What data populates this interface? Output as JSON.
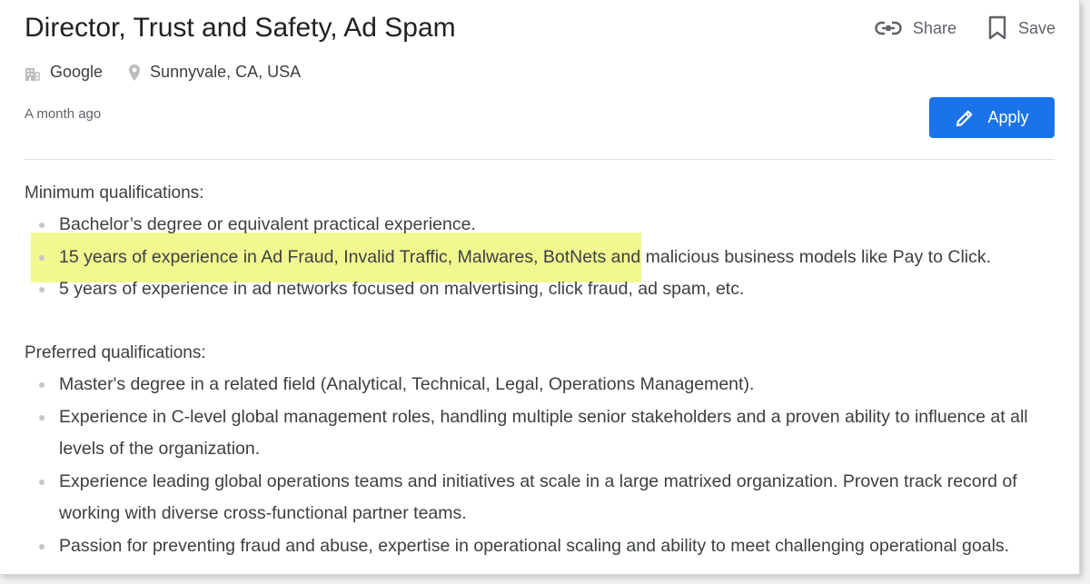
{
  "job": {
    "title": "Director, Trust and Safety, Ad Spam",
    "company": "Google",
    "location": "Sunnyvale, CA, USA",
    "posted": "A month ago"
  },
  "actions": {
    "share_label": "Share",
    "save_label": "Save",
    "apply_label": "Apply"
  },
  "icons": {
    "company": "building-icon",
    "location": "location-pin-icon",
    "share": "link-icon",
    "save": "bookmark-icon",
    "apply": "pencil-icon"
  },
  "colors": {
    "accent": "#1a73e8",
    "highlight": "#eef77b"
  },
  "minimum": {
    "title": "Minimum qualifications:",
    "items": [
      "Bachelor’s degree or equivalent practical experience.",
      "15 years of experience in Ad Fraud, Invalid Traffic, Malwares, BotNets and malicious business models like Pay to Click.",
      "5 years of experience in ad networks focused on malvertising, click fraud, ad spam, etc."
    ]
  },
  "preferred": {
    "title": "Preferred qualifications:",
    "items": [
      "Master's degree in a related field (Analytical, Technical, Legal, Operations Management).",
      "Experience in C-level global management roles, handling multiple senior stakeholders and a proven ability to influence at all levels of the organization.",
      "Experience leading global operations teams and initiatives at scale in a large matrixed organization. Proven track record of working with diverse cross-functional partner teams.",
      "Passion for preventing fraud and abuse, expertise in operational scaling and ability to meet challenging operational goals."
    ]
  }
}
